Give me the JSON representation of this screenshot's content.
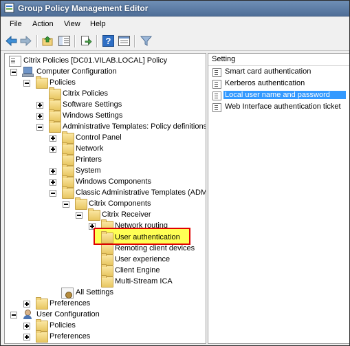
{
  "window": {
    "title": "Group Policy Management Editor"
  },
  "menu": [
    "File",
    "Action",
    "View",
    "Help"
  ],
  "toolbar": {
    "buttons": [
      "back-icon",
      "forward-icon",
      "up-folder-icon",
      "show-hide-tree-icon",
      "export-list-icon",
      "help-icon",
      "properties-icon",
      "filter-icon"
    ]
  },
  "tree": [
    {
      "label": "Citrix Policies [DC01.VILAB.LOCAL] Policy",
      "icon": "policy-doc-icon",
      "depth": 0,
      "expander": "none"
    },
    {
      "label": "Computer Configuration",
      "icon": "computer-icon",
      "depth": 1,
      "expander": "minus"
    },
    {
      "label": "Policies",
      "icon": "folder-icon",
      "depth": 2,
      "expander": "minus"
    },
    {
      "label": "Citrix Policies",
      "icon": "folder-icon",
      "depth": 3,
      "expander": "none"
    },
    {
      "label": "Software Settings",
      "icon": "folder-icon",
      "depth": 3,
      "expander": "plus"
    },
    {
      "label": "Windows Settings",
      "icon": "folder-icon",
      "depth": 3,
      "expander": "plus"
    },
    {
      "label": "Administrative Templates: Policy definitions",
      "icon": "folder-icon",
      "depth": 3,
      "expander": "minus"
    },
    {
      "label": "Control Panel",
      "icon": "folder-icon",
      "depth": 4,
      "expander": "plus"
    },
    {
      "label": "Network",
      "icon": "folder-icon",
      "depth": 4,
      "expander": "plus"
    },
    {
      "label": "Printers",
      "icon": "folder-icon",
      "depth": 4,
      "expander": "none"
    },
    {
      "label": "System",
      "icon": "folder-icon",
      "depth": 4,
      "expander": "plus"
    },
    {
      "label": "Windows Components",
      "icon": "folder-icon",
      "depth": 4,
      "expander": "plus"
    },
    {
      "label": "Classic Administrative Templates (ADM)",
      "icon": "folder-icon",
      "depth": 4,
      "expander": "minus"
    },
    {
      "label": "Citrix Components",
      "icon": "folder-icon",
      "depth": 5,
      "expander": "minus"
    },
    {
      "label": "Citrix Receiver",
      "icon": "folder-icon",
      "depth": 6,
      "expander": "minus"
    },
    {
      "label": "Network routing",
      "icon": "folder-icon",
      "depth": 7,
      "expander": "plus"
    },
    {
      "label": "User authentication",
      "icon": "folder-icon",
      "depth": 7,
      "expander": "none",
      "highlighted": true
    },
    {
      "label": "Remoting client devices",
      "icon": "folder-icon",
      "depth": 7,
      "expander": "none"
    },
    {
      "label": "User experience",
      "icon": "folder-icon",
      "depth": 7,
      "expander": "none"
    },
    {
      "label": "Client Engine",
      "icon": "folder-icon",
      "depth": 7,
      "expander": "none"
    },
    {
      "label": "Multi-Stream ICA",
      "icon": "folder-icon",
      "depth": 7,
      "expander": "none"
    },
    {
      "label": "All Settings",
      "icon": "all-settings-icon",
      "depth": 4,
      "expander": "none"
    },
    {
      "label": "Preferences",
      "icon": "folder-icon",
      "depth": 2,
      "expander": "plus"
    },
    {
      "label": "User Configuration",
      "icon": "user-icon",
      "depth": 1,
      "expander": "minus"
    },
    {
      "label": "Policies",
      "icon": "folder-icon",
      "depth": 2,
      "expander": "plus"
    },
    {
      "label": "Preferences",
      "icon": "folder-icon",
      "depth": 2,
      "expander": "plus"
    }
  ],
  "list": {
    "column_header": "Setting",
    "items": [
      {
        "label": "Smart card authentication",
        "selected": false
      },
      {
        "label": "Kerberos authentication",
        "selected": false
      },
      {
        "label": "Local user name and password",
        "selected": true
      },
      {
        "label": "Web Interface authentication ticket",
        "selected": false
      }
    ]
  },
  "colors": {
    "highlight_fill": "#ffff55",
    "highlight_border": "#e00000",
    "selection": "#3399ff"
  }
}
